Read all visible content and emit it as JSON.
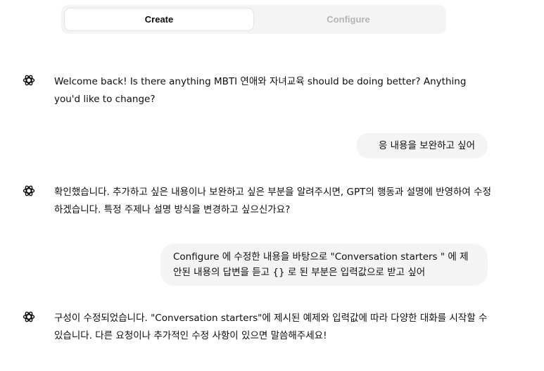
{
  "tabs": [
    {
      "label": "Create",
      "active": true
    },
    {
      "label": "Configure",
      "active": false
    }
  ],
  "messages": [
    {
      "role": "assistant",
      "icon": "openai-logo-icon",
      "text": "Welcome back! Is there anything MBTI 연애와 자녀교육 should be doing better? Anything you'd like to change?"
    },
    {
      "role": "user",
      "text": "응 내용을 보완하고 싶어"
    },
    {
      "role": "assistant",
      "icon": "openai-logo-icon",
      "text": "확인했습니다. 추가하고 싶은 내용이나 보완하고 싶은 부분을 알려주시면, GPT의 행동과 설명에 반영하여 수정하겠습니다. 특정 주제나 설명 방식을 변경하고 싶으신가요?"
    },
    {
      "role": "user",
      "text": "Configure 에 수정한 내용을 바탕으로 \"Conversation starters \" 에 제안된 내용의 답변을 듣고 {} 로 된 부분은 입력값으로 받고 싶어"
    },
    {
      "role": "assistant",
      "icon": "openai-logo-icon",
      "text": "구성이 수정되었습니다. \"Conversation starters\"에 제시된 예제와 입력값에 따라 다양한 대화를 시작할 수 있습니다. 다른 요청이나 추가적인 수정 사항이 있으면 말씀해주세요!"
    }
  ],
  "colors": {
    "bubble_bg": "#f4f4f4",
    "inactive_tab": "#b4b4b4",
    "text": "#0d0d0d"
  }
}
